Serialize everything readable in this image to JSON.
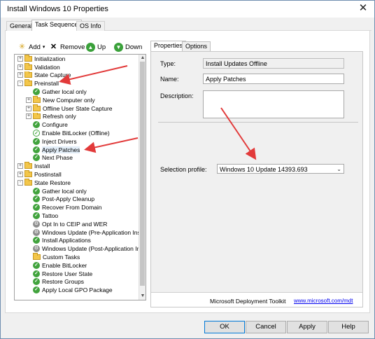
{
  "window": {
    "title": "Install Windows 10 Properties",
    "tabs": [
      "General",
      "Task Sequence",
      "OS Info"
    ]
  },
  "toolbar": {
    "add_label": "Add",
    "remove_label": "Remove",
    "up_label": "Up",
    "down_label": "Down"
  },
  "tree": {
    "items": [
      {
        "label": "Initialization",
        "level": 0,
        "icon": "folder",
        "expander": "+"
      },
      {
        "label": "Validation",
        "level": 0,
        "icon": "folder",
        "expander": "+"
      },
      {
        "label": "State Capture",
        "level": 0,
        "icon": "folder",
        "expander": "+"
      },
      {
        "label": "Preinstall",
        "level": 0,
        "icon": "folder",
        "expander": "-"
      },
      {
        "label": "Gather local only",
        "level": 1,
        "icon": "check",
        "expander": ""
      },
      {
        "label": "New Computer only",
        "level": 1,
        "icon": "folder",
        "expander": "+"
      },
      {
        "label": "Offline User State Capture",
        "level": 1,
        "icon": "folder",
        "expander": "+"
      },
      {
        "label": "Refresh only",
        "level": 1,
        "icon": "folder",
        "expander": "+"
      },
      {
        "label": "Configure",
        "level": 1,
        "icon": "check",
        "expander": ""
      },
      {
        "label": "Enable BitLocker (Offline)",
        "level": 1,
        "icon": "check-outline",
        "expander": ""
      },
      {
        "label": "Inject Drivers",
        "level": 1,
        "icon": "check",
        "expander": ""
      },
      {
        "label": "Apply Patches",
        "level": 1,
        "icon": "check",
        "expander": "",
        "selected": true
      },
      {
        "label": "Next Phase",
        "level": 1,
        "icon": "check",
        "expander": ""
      },
      {
        "label": "Install",
        "level": 0,
        "icon": "folder",
        "expander": "+"
      },
      {
        "label": "Postinstall",
        "level": 0,
        "icon": "folder",
        "expander": "+"
      },
      {
        "label": "State Restore",
        "level": 0,
        "icon": "folder",
        "expander": "-"
      },
      {
        "label": "Gather local only",
        "level": 1,
        "icon": "check",
        "expander": ""
      },
      {
        "label": "Post-Apply Cleanup",
        "level": 1,
        "icon": "check",
        "expander": ""
      },
      {
        "label": "Recover From Domain",
        "level": 1,
        "icon": "check",
        "expander": ""
      },
      {
        "label": "Tattoo",
        "level": 1,
        "icon": "check",
        "expander": ""
      },
      {
        "label": "Opt In to CEIP and WER",
        "level": 1,
        "icon": "gear",
        "expander": ""
      },
      {
        "label": "Windows Update (Pre-Application Inst",
        "level": 1,
        "icon": "gear",
        "expander": ""
      },
      {
        "label": "Install Applications",
        "level": 1,
        "icon": "check",
        "expander": ""
      },
      {
        "label": "Windows Update (Post-Application Ins",
        "level": 1,
        "icon": "gear",
        "expander": ""
      },
      {
        "label": "Custom Tasks",
        "level": 1,
        "icon": "folder",
        "expander": ""
      },
      {
        "label": "Enable BitLocker",
        "level": 1,
        "icon": "check",
        "expander": ""
      },
      {
        "label": "Restore User State",
        "level": 1,
        "icon": "check",
        "expander": ""
      },
      {
        "label": "Restore Groups",
        "level": 1,
        "icon": "check",
        "expander": ""
      },
      {
        "label": "Apply Local GPO Package",
        "level": 1,
        "icon": "check",
        "expander": ""
      }
    ]
  },
  "properties": {
    "tabs": [
      "Properties",
      "Options"
    ],
    "type_label": "Type:",
    "type_value": "Install Updates Offline",
    "name_label": "Name:",
    "name_value": "Apply Patches",
    "description_label": "Description:",
    "description_value": "",
    "selection_profile_label": "Selection profile:",
    "selection_profile_value": "Windows 10 Update 14393.693",
    "brand": "Microsoft Deployment Toolkit",
    "brand_link": "www.microsoft.com/mdt"
  },
  "buttons": {
    "ok": "OK",
    "cancel": "Cancel",
    "apply": "Apply",
    "help": "Help"
  },
  "colors": {
    "annotation_arrow": "#e23a3a",
    "success_icon": "#41a33d",
    "folder": "#f3c64a"
  }
}
